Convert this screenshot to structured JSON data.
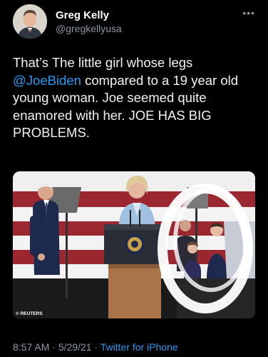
{
  "author": {
    "name": "Greg Kelly",
    "handle": "@gregkellyusa"
  },
  "tweet": {
    "text_before": "That’s The little girl whose legs ",
    "mention": "@JoeBiden",
    "text_after": " compared to a 19 year old young woman. Joe seemed quite enamored with her.  JOE HAS BIG PROBLEMS."
  },
  "media": {
    "credit": "© REUTERS",
    "description_icon": "photo"
  },
  "meta": {
    "time": "8:57 AM",
    "separator": " · ",
    "date": "5/29/21",
    "source": "Twitter for iPhone"
  },
  "icons": {
    "more": "more-horizontal-icon"
  },
  "colors": {
    "background": "#000000",
    "link": "#1d9bf0",
    "secondary": "#8b98a5"
  }
}
